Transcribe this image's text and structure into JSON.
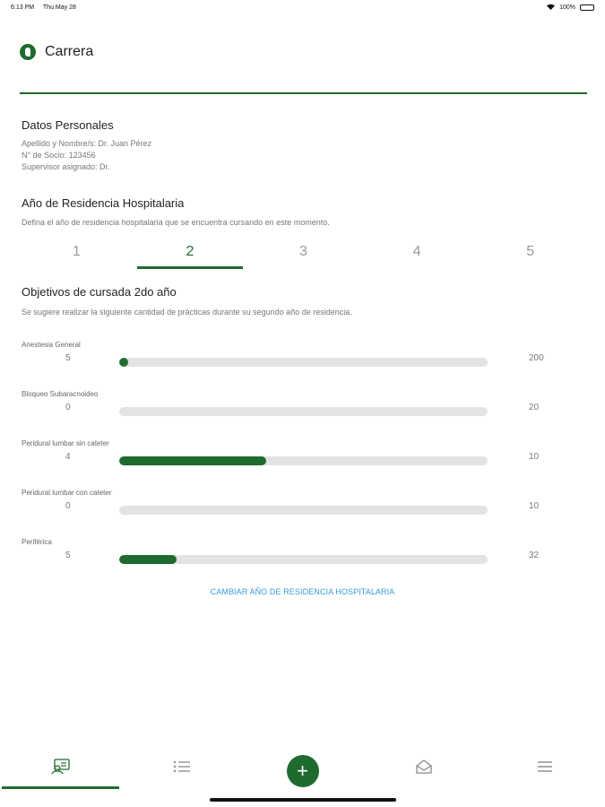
{
  "status_bar": {
    "time": "6:13 PM",
    "date": "Thu May 28",
    "battery": "100%"
  },
  "header": {
    "title": "Carrera"
  },
  "personal": {
    "title": "Datos Personales",
    "name_line": "Apellido y Nombre/s: Dr. Juan Pérez",
    "member_line": "N° de Socio: 123456",
    "supervisor_line": "Supervisor asignado: Dr."
  },
  "residency": {
    "title": "Año de Residencia Hospitalaria",
    "description": "Defina el año de residencia hospitalaria que se encuentra cursando en este momento.",
    "years": [
      "1",
      "2",
      "3",
      "4",
      "5"
    ],
    "selected_index": 1
  },
  "objectives": {
    "title": "Objetivos de cursada 2do año",
    "description": "Se sugiere realizar la siguiente cantidad de prácticas durante su segundo año de residencia.",
    "items": [
      {
        "name": "Anestesia General",
        "current": "5",
        "target": "200",
        "progress": 0.025
      },
      {
        "name": "Bloqueo Subaracnoideo",
        "current": "0",
        "target": "20",
        "progress": 0
      },
      {
        "name": "Peridural lumbar sin cateter",
        "current": "4",
        "target": "10",
        "progress": 0.4
      },
      {
        "name": "Peridural lumbar con cateter",
        "current": "0",
        "target": "10",
        "progress": 0
      },
      {
        "name": "Periférica",
        "current": "5",
        "target": "32",
        "progress": 0.156
      }
    ]
  },
  "change_link": "CAMBIAR AÑO DE RESIDENCIA HOSPITALARIA",
  "tabbar": {
    "icons": [
      "profile-icon",
      "list-icon",
      "plus-icon",
      "inbox-icon",
      "menu-icon"
    ],
    "fab_symbol": "+"
  },
  "colors": {
    "accent": "#1f6b2f",
    "link": "#3a9ad9",
    "track": "#e3e3e3"
  }
}
